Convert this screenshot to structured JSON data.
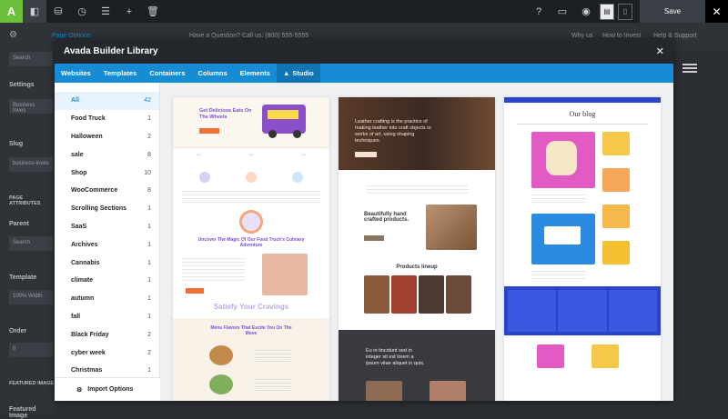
{
  "topbar": {
    "logo": "A",
    "save_label": "Save"
  },
  "background_page": {
    "tab_page_options": "Page Options",
    "phone_text": "Have a Question? Call us: (800) 555-5555",
    "nav_links": [
      "Why us",
      "How to Invest",
      "Help & Support"
    ],
    "sidebar_labels": [
      "Settings",
      "Slug",
      "PAGE ATTRIBUTES",
      "Parent",
      "Template",
      "Order",
      "FEATURED IMAGE",
      "Featured Image"
    ],
    "sidebar_values": {
      "search": "Search",
      "business_invest": "Business Inves",
      "slug": "business-inves",
      "parent": "Search",
      "template": "100% Width",
      "order": "0"
    }
  },
  "modal": {
    "title": "Avada Builder Library",
    "tabs": [
      {
        "label": "Websites"
      },
      {
        "label": "Templates"
      },
      {
        "label": "Containers"
      },
      {
        "label": "Columns"
      },
      {
        "label": "Elements"
      },
      {
        "label": "Studio",
        "active": true
      }
    ],
    "categories": [
      {
        "label": "All",
        "count": "42",
        "active": true
      },
      {
        "label": "Food Truck",
        "count": "1"
      },
      {
        "label": "Halloween",
        "count": "2"
      },
      {
        "label": "sale",
        "count": "8"
      },
      {
        "label": "Shop",
        "count": "10"
      },
      {
        "label": "WooCommerce",
        "count": "8"
      },
      {
        "label": "Scrolling Sections",
        "count": "1"
      },
      {
        "label": "SaaS",
        "count": "1"
      },
      {
        "label": "Archives",
        "count": "1"
      },
      {
        "label": "Cannabis",
        "count": "1"
      },
      {
        "label": "climate",
        "count": "1"
      },
      {
        "label": "autumn",
        "count": "1"
      },
      {
        "label": "fall",
        "count": "1"
      },
      {
        "label": "Black Friday",
        "count": "2"
      },
      {
        "label": "cyber week",
        "count": "2"
      },
      {
        "label": "Christmas",
        "count": "1"
      }
    ],
    "import_label": "Import Options",
    "previews": {
      "food_truck": {
        "hero_title": "Get Delicious Eats On The Wheels",
        "story_title": "Uncover The Magic Of Our Food Truck's Culinary Adventure",
        "slogan": "Satisfy Your Cravings",
        "menu_title": "Menu Flavors That Excite You On The Move"
      },
      "leather": {
        "hero_text": "Leather crafting is the practice of making leather into craft objects or works of art, using shaping techniques.",
        "sub_title": "Beautifully hand crafted products.",
        "lineup_title": "Products lineup",
        "dark_text": "Eu in tincidunt sed in integer sit est lorem a ipsum vitae aliquet in quis."
      },
      "blog": {
        "title": "Our blog"
      }
    }
  },
  "colors": {
    "accent": "#168cd5",
    "logo_green": "#6bbf3a",
    "topbar": "#1d2023"
  }
}
